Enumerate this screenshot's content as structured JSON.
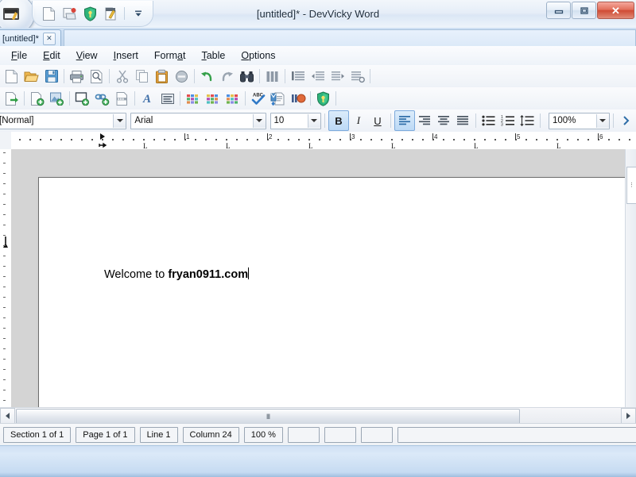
{
  "window": {
    "title": "[untitled]* - DevVicky Word",
    "controls": {
      "minimize": "—",
      "maximize": "❐",
      "close": "✕"
    },
    "orb_icon": "office-orb-icon"
  },
  "quick_access": {
    "items": [
      {
        "name": "new-document-icon",
        "label": "New"
      },
      {
        "name": "open-recent-icon",
        "label": "Open Recent"
      },
      {
        "name": "shield-icon",
        "label": "Protect"
      },
      {
        "name": "edit-document-icon",
        "label": "Edit"
      }
    ],
    "customize": {
      "name": "chevron-down-icon",
      "label": "Customize Quick Access Toolbar"
    }
  },
  "tabs": [
    {
      "label": "[untitled]*",
      "close": "✕",
      "active": true
    }
  ],
  "menu": {
    "items": [
      {
        "label": "File",
        "mnemonic": "F"
      },
      {
        "label": "Edit",
        "mnemonic": "E"
      },
      {
        "label": "View",
        "mnemonic": "V"
      },
      {
        "label": "Insert",
        "mnemonic": "I"
      },
      {
        "label": "Format",
        "mnemonic": "a"
      },
      {
        "label": "Table",
        "mnemonic": "T"
      },
      {
        "label": "Options",
        "mnemonic": "O"
      }
    ]
  },
  "toolbar_standard": {
    "items": [
      {
        "name": "new-file-icon",
        "label": "New"
      },
      {
        "name": "open-folder-icon",
        "label": "Open"
      },
      {
        "name": "save-icon",
        "label": "Save"
      },
      {
        "sep": true
      },
      {
        "name": "print-icon",
        "label": "Print"
      },
      {
        "name": "print-preview-icon",
        "label": "Print Preview"
      },
      {
        "sep": true
      },
      {
        "name": "cut-scissors-icon",
        "label": "Cut"
      },
      {
        "name": "copy-icon",
        "label": "Copy"
      },
      {
        "name": "paste-icon",
        "label": "Paste"
      },
      {
        "name": "delete-icon",
        "label": "Delete"
      },
      {
        "sep": true
      },
      {
        "name": "undo-icon",
        "label": "Undo"
      },
      {
        "name": "redo-icon",
        "label": "Redo"
      },
      {
        "name": "find-binoculars-icon",
        "label": "Find"
      },
      {
        "sep": true
      },
      {
        "name": "columns-icon",
        "label": "Columns"
      },
      {
        "sep": true
      },
      {
        "name": "paragraph-icon",
        "label": "Paragraph"
      },
      {
        "name": "decrease-indent-icon",
        "label": "Decrease Indent"
      },
      {
        "name": "increase-indent-icon",
        "label": "Increase Indent"
      },
      {
        "name": "paragraph-settings-icon",
        "label": "Paragraph Settings"
      }
    ]
  },
  "toolbar_insert": {
    "items": [
      {
        "name": "export-document-icon",
        "label": "Export"
      },
      {
        "sep": true
      },
      {
        "name": "insert-document-icon",
        "label": "Insert Document"
      },
      {
        "name": "insert-image-icon",
        "label": "Insert Image"
      },
      {
        "sep": true
      },
      {
        "name": "insert-textbox-icon",
        "label": "Insert Text Box"
      },
      {
        "name": "insert-link-icon",
        "label": "Insert Link"
      },
      {
        "name": "insert-page-break-icon",
        "label": "Page Break"
      },
      {
        "sep": true
      },
      {
        "name": "text-art-icon",
        "label": "Text Art"
      },
      {
        "name": "insert-frame-icon",
        "label": "Frame"
      },
      {
        "sep": true
      },
      {
        "name": "insert-table-icon",
        "label": "Insert Table"
      },
      {
        "name": "table-grid-icon",
        "label": "Table Grid"
      },
      {
        "name": "table-style-icon",
        "label": "Table Style"
      },
      {
        "sep": true
      },
      {
        "name": "spell-check-icon",
        "label": "Spell Check"
      },
      {
        "name": "mail-merge-icon",
        "label": "Mail Merge"
      },
      {
        "name": "record-macro-icon",
        "label": "Record Macro"
      },
      {
        "sep": true
      },
      {
        "name": "shield-icon",
        "label": "Protect Document"
      }
    ]
  },
  "format_bar": {
    "style": {
      "value": "[Normal]",
      "placeholder": "Style"
    },
    "font": {
      "value": "Arial",
      "placeholder": "Font"
    },
    "size": {
      "value": "10",
      "placeholder": "Size"
    },
    "bold": {
      "label": "B",
      "name": "bold-button",
      "active": true
    },
    "italic": {
      "label": "I",
      "name": "italic-button",
      "active": false
    },
    "underline": {
      "label": "U",
      "name": "underline-button",
      "active": false
    },
    "align": [
      {
        "name": "align-left-icon",
        "label": "Align Left",
        "active": true
      },
      {
        "name": "align-right-icon",
        "label": "Align Right",
        "active": false
      },
      {
        "name": "align-center-icon",
        "label": "Center",
        "active": false
      },
      {
        "name": "align-justify-icon",
        "label": "Justify",
        "active": false
      }
    ],
    "lists": [
      {
        "name": "bullet-list-icon",
        "label": "Bullets"
      },
      {
        "name": "numbered-list-icon",
        "label": "Numbering"
      },
      {
        "name": "line-spacing-icon",
        "label": "Line Spacing"
      }
    ],
    "zoom": {
      "value": "100%",
      "placeholder": "Zoom"
    }
  },
  "ruler": {
    "numbers": [
      "1",
      "2",
      "3",
      "4",
      "5",
      "6"
    ],
    "tab_marker": "L",
    "unit": "inch"
  },
  "document": {
    "text_plain": "Welcome to ",
    "text_bold": "fryan0911.com",
    "caret": "|"
  },
  "scrollbar": {
    "left_arrow": "◀",
    "right_arrow": "▶",
    "grip": "llll"
  },
  "status_bar": {
    "section": "Section 1 of 1",
    "page": "Page 1 of 1",
    "line": "Line 1",
    "column": "Column 24",
    "zoom": "100 %",
    "empty_panels": [
      "",
      "",
      ""
    ],
    "message": ""
  }
}
